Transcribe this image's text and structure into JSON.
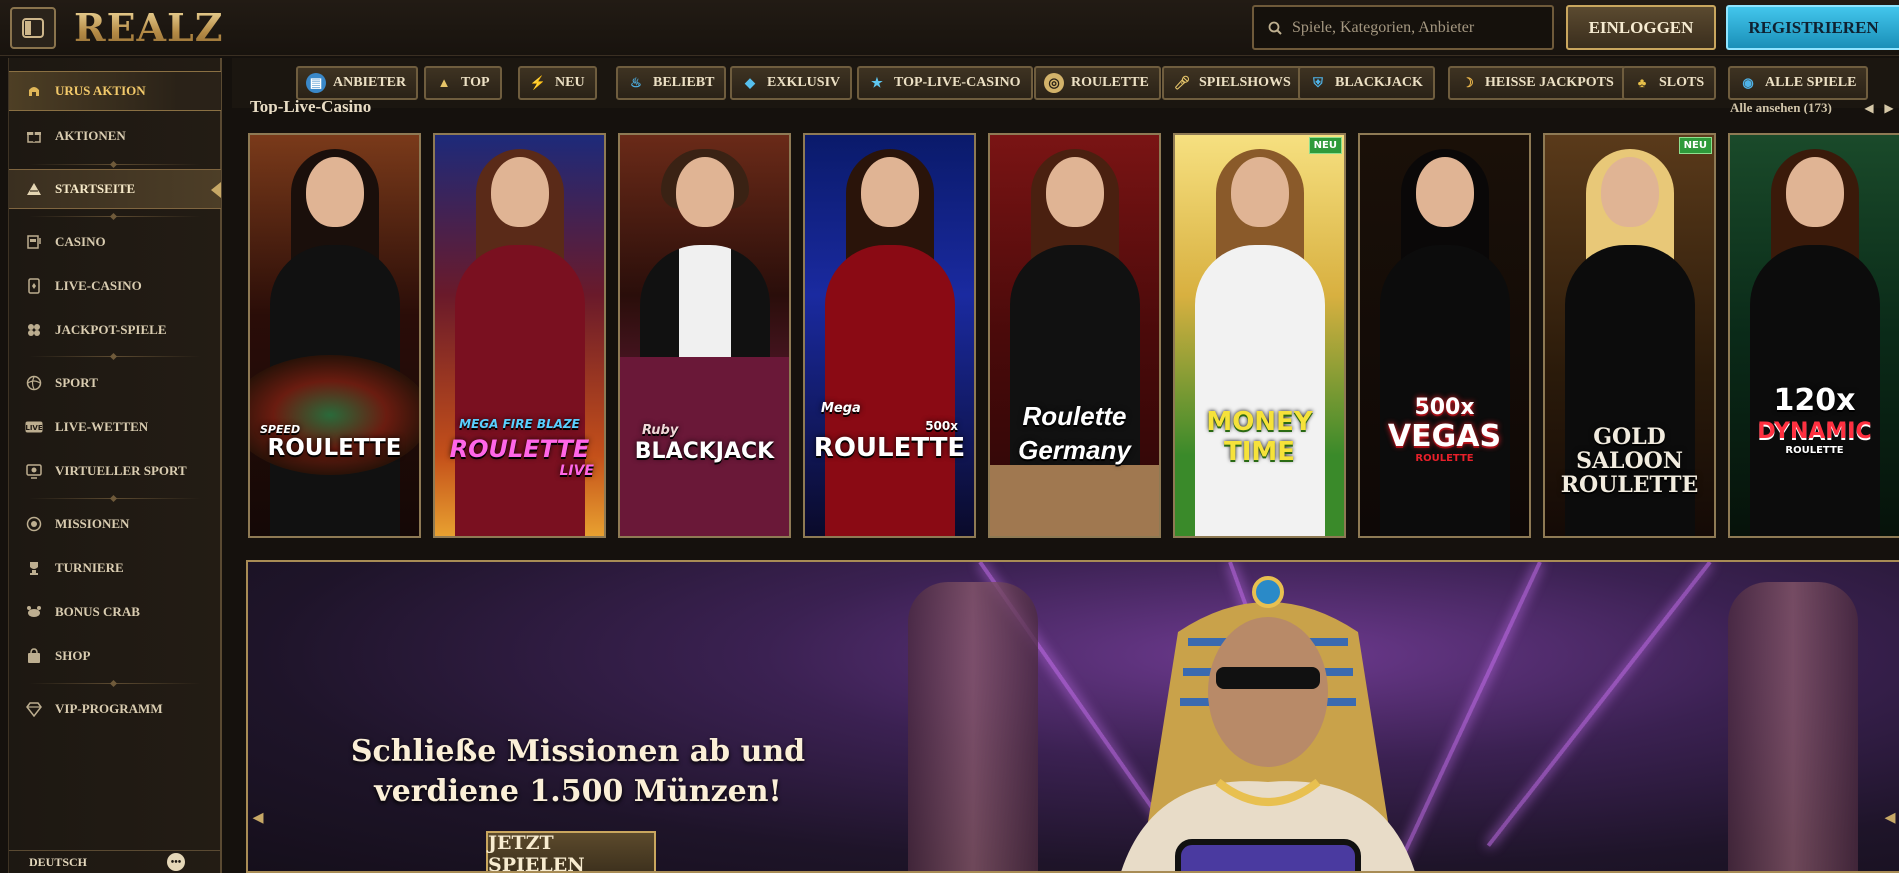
{
  "header": {
    "logo_text": "REALZ",
    "search_placeholder": "Spiele, Kategorien, Anbieter",
    "login_label": "EINLOGGEN",
    "register_label": "REGISTRIEREN"
  },
  "sidebar": {
    "items": [
      {
        "label": "URUS AKTION",
        "icon": "helmet-icon"
      },
      {
        "label": "AKTIONEN",
        "icon": "gift-icon"
      },
      {
        "label": "STARTSEITE",
        "icon": "pyramid-icon"
      },
      {
        "label": "CASINO",
        "icon": "slot-machine-icon"
      },
      {
        "label": "LIVE-CASINO",
        "icon": "card-icon"
      },
      {
        "label": "JACKPOT-SPIELE",
        "icon": "clover-icon"
      },
      {
        "label": "SPORT",
        "icon": "ball-icon"
      },
      {
        "label": "LIVE-WETTEN",
        "icon": "live-icon"
      },
      {
        "label": "VIRTUELLER SPORT",
        "icon": "virtual-sport-icon"
      },
      {
        "label": "MISSIONEN",
        "icon": "target-icon"
      },
      {
        "label": "TURNIERE",
        "icon": "trophy-icon"
      },
      {
        "label": "BONUS CRAB",
        "icon": "crab-icon"
      },
      {
        "label": "SHOP",
        "icon": "bag-icon"
      },
      {
        "label": "VIP-PROGRAMM",
        "icon": "diamond-icon"
      }
    ],
    "language": "DEUTSCH"
  },
  "categories": [
    {
      "label": "ANBIETER",
      "icon": "provider-icon"
    },
    {
      "label": "TOP",
      "icon": "pyramid-icon"
    },
    {
      "label": "NEU",
      "icon": "lightning-icon"
    },
    {
      "label": "BELIEBT",
      "icon": "flame-icon"
    },
    {
      "label": "EXKLUSIV",
      "icon": "gem-icon"
    },
    {
      "label": "TOP-LIVE-CASINO",
      "icon": "star-icon"
    },
    {
      "label": "ROULETTE",
      "icon": "roulette-icon"
    },
    {
      "label": "SPIELSHOWS",
      "icon": "microphone-icon"
    },
    {
      "label": "BLACKJACK",
      "icon": "shield-icon"
    },
    {
      "label": "HEISSE JACKPOTS",
      "icon": "chili-icon"
    },
    {
      "label": "SLOTS",
      "icon": "cherries-icon"
    },
    {
      "label": "ALLE SPIELE",
      "icon": "coins-icon"
    }
  ],
  "games_section": {
    "title": "Top-Live-Casino",
    "see_all": "Alle ansehen (173)",
    "games": [
      {
        "title_small": "SPEED",
        "title": "ROULETTE",
        "badge": ""
      },
      {
        "title_small": "MEGA FIRE BLAZE",
        "title": "ROULETTE",
        "title_extra": "LIVE",
        "badge": ""
      },
      {
        "title_small": "Ruby",
        "title": "BLACKJACK",
        "badge": ""
      },
      {
        "title_small": "Mega",
        "title": "ROULETTE",
        "title_extra": "500x",
        "badge": ""
      },
      {
        "title": "Roulette Germany",
        "badge": ""
      },
      {
        "title": "MONEY TIME",
        "badge": "NEU"
      },
      {
        "title_small": "500x",
        "title": "VEGAS",
        "title_extra": "ROULETTE",
        "badge": ""
      },
      {
        "title": "GOLD SALOON ROULETTE",
        "badge": "NEU"
      },
      {
        "title_small": "120x",
        "title": "DYNAMIC",
        "title_extra": "ROULETTE",
        "badge": ""
      }
    ]
  },
  "hero": {
    "headline_line1": "Schließe Missionen ab und",
    "headline_line2": "verdiene 1.500 Münzen!",
    "cta_label": "JETZT SPIELEN"
  }
}
